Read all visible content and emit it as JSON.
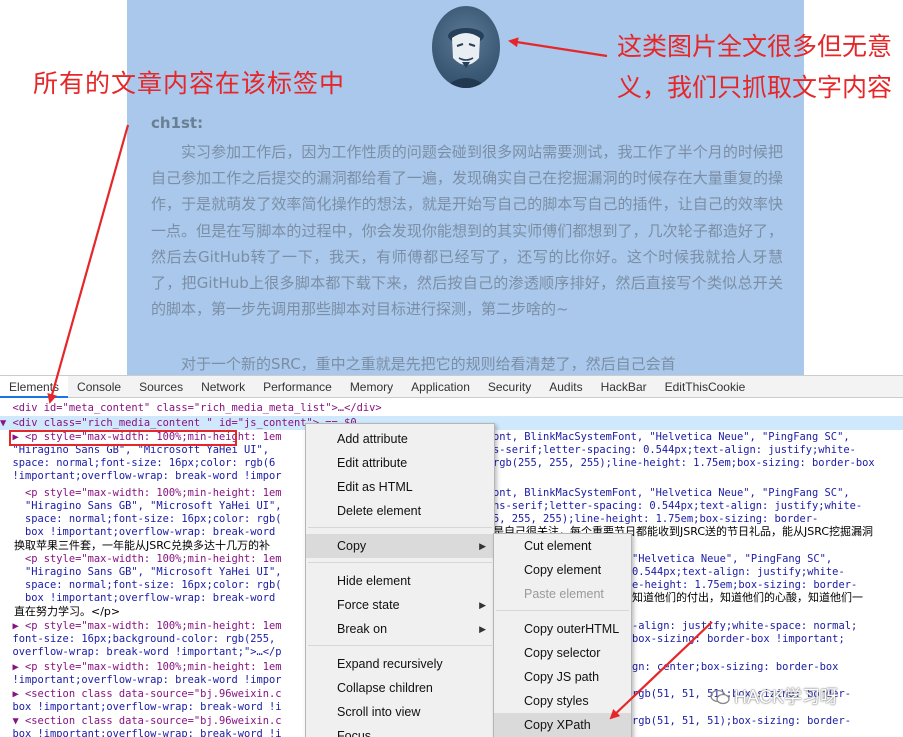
{
  "article": {
    "author": "ch1st:",
    "paragraph1": "实习参加工作后，因为工作性质的问题会碰到很多网站需要测试，我工作了半个月的时候把自己参加工作之后提交的漏洞都给看了一遍，发现确实自己在挖掘漏洞的时候存在大量重复的操作，于是就萌发了效率简化操作的想法，就是开始写自己的脚本写自己的插件，让自己的效率快一点。但是在写脚本的过程中，你会发现你能想到的其实师傅们都想到了，几次轮子都造好了，然后去GitHub转了一下，我天，有师傅都已经写了，还写的比你好。这个时候我就拾人牙慧了，把GitHub上很多脚本都下载下来，然后按自己的渗透顺序排好，然后直接写个类似总开关的脚本，第一步先调用那些脚本对目标进行探测，第二步啥的~",
    "paragraph2": "对于一个新的SRC，重中之重就是先把它的规则给看清楚了，然后自己会首"
  },
  "annotations": {
    "left": "所有的文章内容在该标签中",
    "right": "这类图片全文很多但无意义，我们只抓取文字内容"
  },
  "devtools": {
    "tabs": [
      "Elements",
      "Console",
      "Sources",
      "Network",
      "Performance",
      "Memory",
      "Application",
      "Security",
      "Audits",
      "HackBar",
      "EditThisCookie"
    ],
    "active_tab": "Elements"
  },
  "code": {
    "l0_pre": "  <div id=\"meta_content\" class=\"rich_media_meta_list\">…</div>",
    "l1": "▼ <div class=\"rich_media_content \" id=\"js_content\"> == $0",
    "l2a": "  ▶ <p style=\"max-width: 100%;min-height: 1em",
    "l2b": "ont, BlinkMacSystemFont, \"Helvetica Neue\", \"PingFang SC\",",
    "l3a": "  \"Hiragino Sans GB\", \"Microsoft YaHei UI\",",
    "l3b": "s-serif;letter-spacing: 0.544px;text-align: justify;white-",
    "l4a": "  space: normal;font-size: 16px;color: rgb(6",
    "l4b": "rgb(255, 255, 255);line-height: 1.75em;box-sizing: border-box",
    "l5": "  !important;overflow-wrap: break-word !impor",
    "l6a": "    <p style=\"max-width: 100%;min-height: 1em",
    "l6b": "ont, BlinkMacSystemFont, \"Helvetica Neue\", \"PingFang SC\",",
    "l7a": "    \"Hiragino Sans GB\", \"Microsoft YaHei UI\",",
    "l7b": "ns-serif;letter-spacing: 0.544px;text-align: justify;white-",
    "l8a": "    space: normal;font-size: 16px;color: rgb(",
    "l8b": "5, 255, 255);line-height: 1.75em;box-sizing: border-",
    "l9a": "    box !important;overflow-wrap: break-word",
    "l9b": "是自己很关注，每个重要节日都能收到JSRC送的节日礼品，能从JSRC挖掘漏洞",
    "l10": "    换取苹果三件套，一年能从JSRC兑换多达十几万的补",
    "l11a": "    <p style=\"max-width: 100%;min-height: 1em",
    "l11b": "\"Helvetica Neue\", \"PingFang SC\",",
    "l12a": "    \"Hiragino Sans GB\", \"Microsoft YaHei UI\",",
    "l12b": "0.544px;text-align: justify;white-",
    "l13a": "    space: normal;font-size: 16px;color: rgb(",
    "l13b": "e-height: 1.75em;box-sizing: border-",
    "l14a": "    box !important;overflow-wrap: break-word",
    "l14b": "知道他们的付出，知道他们的心酸，知道他们一",
    "l15": "    直在努力学习。</p>",
    "l16a": "  ▶ <p style=\"max-width: 100%;min-height: 1em",
    "l16b": "-align: justify;white-space: normal;",
    "l17a": "  font-size: 16px;background-color: rgb(255,",
    "l17b": "box-sizing: border-box !important;",
    "l18": "  overflow-wrap: break-word !important;\">…</p",
    "l19a": "  ▶ <p style=\"max-width: 100%;min-height: 1em",
    "l19b": "gn: center;box-sizing: border-box",
    "l20": "  !important;overflow-wrap: break-word !impor",
    "l21a": "  ▶ <section class data-source=\"bj.96weixin.c",
    "l21b": "rgb(51, 51, 51);box-sizing: border-",
    "l22": "  box !important;overflow-wrap: break-word !i",
    "l23a": "  ▼ <section class data-source=\"bj.96weixin.c",
    "l23b": "rgb(51, 51, 51);box-sizing: border-",
    "l24": "  box !important;overflow-wrap: break-word !i"
  },
  "context_menu": {
    "add_attribute": "Add attribute",
    "edit_attribute": "Edit attribute",
    "edit_as_html": "Edit as HTML",
    "delete_element": "Delete element",
    "copy": "Copy",
    "hide_element": "Hide element",
    "force_state": "Force state",
    "break_on": "Break on",
    "expand_recursively": "Expand recursively",
    "collapse_children": "Collapse children",
    "scroll_into_view": "Scroll into view",
    "focus": "Focus"
  },
  "copy_submenu": {
    "cut_element": "Cut element",
    "copy_element": "Copy element",
    "paste_element": "Paste element",
    "copy_outerhtml": "Copy outerHTML",
    "copy_selector": "Copy selector",
    "copy_js_path": "Copy JS path",
    "copy_styles": "Copy styles",
    "copy_xpath": "Copy XPath"
  },
  "watermark": "HACK学习呀",
  "colors": {
    "article_bg": "#a9c8eb",
    "annotation_red": "#e6272a",
    "selected_row": "#cfe8fc"
  }
}
